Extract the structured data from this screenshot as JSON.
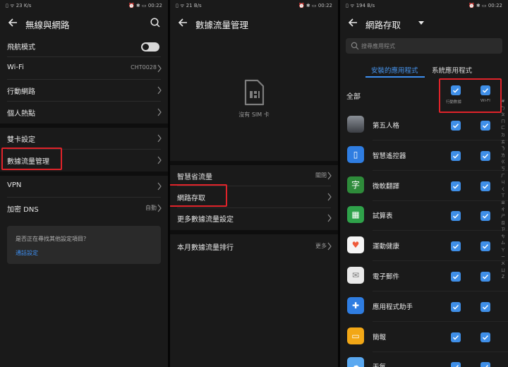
{
  "status_bar": {
    "left_p1": "▯ ᯤ 23 K/s",
    "left_p2": "▯ ᯤ 21 B/s",
    "left_p3": "▯ ᯤ 194 B/s",
    "right": "⏰ ✱ ▭ 00:22"
  },
  "panel1": {
    "title": "無線與網路",
    "items": [
      {
        "label": "飛航模式"
      },
      {
        "label": "Wi-Fi",
        "value": "CHT0028"
      },
      {
        "label": "行動網路"
      },
      {
        "label": "個人熱點"
      },
      {
        "label": "雙卡設定"
      },
      {
        "label": "數據流量管理"
      },
      {
        "label": "VPN"
      },
      {
        "label": "加密 DNS",
        "value": "自動"
      }
    ],
    "card": {
      "question": "是否正在尋找其他設定項目？",
      "link": "通話設定"
    }
  },
  "panel2": {
    "title": "數據流量管理",
    "no_sim": "沒有 SIM 卡",
    "items": [
      {
        "label": "智慧省流量",
        "value": "關閉"
      },
      {
        "label": "網路存取"
      },
      {
        "label": "更多數據流量設定"
      },
      {
        "label": "本月數據流量排行",
        "value": "更多"
      }
    ]
  },
  "panel3": {
    "title": "網路存取",
    "search_placeholder": "搜尋應用程式",
    "tabs": [
      "安裝的應用程式",
      "系統應用程式"
    ],
    "all_label": "全部",
    "col_mobile": "行動數據",
    "col_wifi": "WI-FI",
    "apps": [
      {
        "name": "第五人格"
      },
      {
        "name": "智慧遙控器"
      },
      {
        "name": "微軟翻譯"
      },
      {
        "name": "試算表"
      },
      {
        "name": "運動健康"
      },
      {
        "name": "電子郵件"
      },
      {
        "name": "應用程式助手"
      },
      {
        "name": "簡報"
      },
      {
        "name": "天氣"
      }
    ],
    "index": [
      "#",
      "ㄅ",
      "ㄆ",
      "ㄇ",
      "ㄈ",
      "ㄉ",
      "ㄊ",
      "ㄋ",
      "ㄌ",
      "ㄍ",
      "ㄎ",
      "ㄏ",
      "ㄐ",
      "ㄑ",
      "ㄒ",
      "ㄓ",
      "ㄔ",
      "ㄕ",
      "ㄖ",
      "ㄗ",
      "ㄘ",
      "ㄙ",
      "ㄚ",
      "ㄧ",
      "ㄨ",
      "ㄩ",
      "Z"
    ]
  },
  "colors": {
    "accent": "#3d8ef0",
    "highlight": "#e0232a",
    "background": "#1a1a1a"
  }
}
